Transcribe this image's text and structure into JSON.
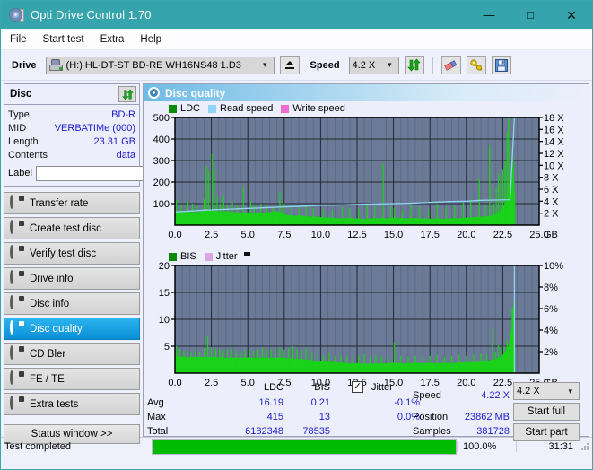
{
  "window": {
    "title": "Opti Drive Control 1.70",
    "icon": "disc-icon",
    "minimize": "—",
    "maximize": "□",
    "close": "✕",
    "titlebar_color": "#35a4ac"
  },
  "menu": {
    "items": [
      {
        "label": "File"
      },
      {
        "label": "Start test"
      },
      {
        "label": "Extra"
      },
      {
        "label": "Help"
      }
    ]
  },
  "toolbar": {
    "drive_label": "Drive",
    "drive_value": "(H:)  HL-DT-ST BD-RE  WH16NS48 1.D3",
    "eject_icon": "eject-icon",
    "speed_label": "Speed",
    "speed_value": "4.2 X",
    "refresh_icon": "refresh-icon",
    "eraser_icon": "eraser-icon",
    "key_icon": "key-icon",
    "save_icon": "save-disk-icon"
  },
  "sidebar": {
    "disc_group": {
      "title": "Disc",
      "refresh_icon": "refresh-icon",
      "rows": [
        {
          "key": "Type",
          "value": "BD-R"
        },
        {
          "key": "MID",
          "value": "VERBATIMe (000)"
        },
        {
          "key": "Length",
          "value": "23.31 GB"
        },
        {
          "key": "Contents",
          "value": "data"
        }
      ],
      "label_key": "Label",
      "label_value": "",
      "label_placeholder": "",
      "label_button_icon": "disc-icon"
    },
    "nav": [
      {
        "label": "Transfer rate",
        "icon": "disc-icon",
        "selected": false
      },
      {
        "label": "Create test disc",
        "icon": "disc-icon",
        "selected": false
      },
      {
        "label": "Verify test disc",
        "icon": "disc-icon",
        "selected": false
      },
      {
        "label": "Drive info",
        "icon": "disc-icon",
        "selected": false
      },
      {
        "label": "Disc info",
        "icon": "disc-icon",
        "selected": false
      },
      {
        "label": "Disc quality",
        "icon": "disc-icon",
        "selected": true
      },
      {
        "label": "CD Bler",
        "icon": "disc-icon",
        "selected": false
      },
      {
        "label": "FE / TE",
        "icon": "disc-icon",
        "selected": false
      },
      {
        "label": "Extra tests",
        "icon": "disc-icon",
        "selected": false
      }
    ],
    "status_window_button": "Status window >>"
  },
  "panel": {
    "title": "Disc quality",
    "icon": "disc-icon"
  },
  "stats": {
    "col_ldc": "LDC",
    "col_bis": "BIS",
    "jitter_label": "Jitter",
    "jitter_checked": true,
    "rows": [
      {
        "name": "Avg",
        "ldc": "16.19",
        "bis": "0.21",
        "jitter": "-0.1%"
      },
      {
        "name": "Max",
        "ldc": "415",
        "bis": "13",
        "jitter": "0.0%"
      },
      {
        "name": "Total",
        "ldc": "6182348",
        "bis": "78535",
        "jitter": ""
      }
    ],
    "speed_label": "Speed",
    "speed_value": "4.22 X",
    "position_label": "Position",
    "position_value": "23862 MB",
    "samples_label": "Samples",
    "samples_value": "381728",
    "speed_select": "4.2 X",
    "start_full": "Start full",
    "start_part": "Start part"
  },
  "statusbar": {
    "message": "Test completed",
    "progress_percent": "100.0%",
    "progress_value": 100,
    "elapsed": "31:31",
    "progress_color": "#00bb00"
  },
  "chart_data": [
    {
      "type": "area",
      "id": "ldc-chart",
      "title": "",
      "xlabel": "GB",
      "ylabel": "",
      "xlim": [
        0,
        25
      ],
      "ylim": [
        0,
        500
      ],
      "y2lim": [
        0,
        18
      ],
      "xticks": [
        "0.0",
        "2.5",
        "5.0",
        "7.5",
        "10.0",
        "12.5",
        "15.0",
        "17.5",
        "20.0",
        "22.5",
        "25.0"
      ],
      "yticks": [
        "100",
        "200",
        "300",
        "400",
        "500"
      ],
      "y2ticks": [
        "2 X",
        "4 X",
        "6 X",
        "8 X",
        "10 X",
        "12 X",
        "14 X",
        "16 X",
        "18 X"
      ],
      "grid": true,
      "plot_bg": "#6b7a96",
      "legend_position": "top-left",
      "legend": [
        {
          "name": "LDC",
          "color": "#0a8a0a"
        },
        {
          "name": "Read speed",
          "color": "#8fd4f2"
        },
        {
          "name": "Write speed",
          "color": "#f06bd2"
        }
      ],
      "series": [
        {
          "name": "LDC",
          "color": "#19d219",
          "type": "area",
          "x": [
            0.0,
            0.25,
            0.5,
            0.75,
            1.0,
            1.25,
            1.5,
            1.75,
            2.0,
            2.25,
            2.5,
            2.75,
            3.0,
            3.25,
            3.5,
            3.75,
            4.0,
            4.25,
            4.5,
            4.75,
            5.0,
            5.25,
            5.5,
            5.75,
            6.0,
            6.25,
            6.5,
            6.75,
            7.0,
            7.25,
            7.5,
            7.75,
            8.0,
            8.25,
            8.5,
            8.75,
            9.0,
            9.25,
            9.5,
            9.75,
            10.0,
            10.5,
            11.0,
            11.5,
            12.0,
            12.5,
            13.0,
            13.5,
            14.0,
            14.5,
            15.0,
            15.5,
            16.0,
            16.5,
            17.0,
            17.5,
            18.0,
            18.5,
            19.0,
            19.5,
            20.0,
            20.5,
            21.0,
            21.5,
            22.0,
            22.25,
            22.5,
            22.75,
            23.0,
            23.2,
            23.35
          ],
          "y": [
            70,
            62,
            58,
            60,
            62,
            60,
            58,
            62,
            70,
            64,
            66,
            68,
            62,
            60,
            64,
            62,
            60,
            58,
            56,
            60,
            58,
            56,
            54,
            58,
            56,
            58,
            60,
            62,
            64,
            60,
            50,
            46,
            44,
            42,
            44,
            42,
            40,
            38,
            40,
            38,
            36,
            34,
            32,
            30,
            32,
            30,
            28,
            30,
            32,
            30,
            34,
            32,
            30,
            32,
            30,
            28,
            30,
            28,
            30,
            32,
            34,
            36,
            38,
            40,
            48,
            60,
            80,
            110,
            190,
            320,
            100
          ]
        },
        {
          "name": "LDC spikes",
          "color": "#19d219",
          "type": "impulse",
          "x": [
            0.1,
            0.45,
            0.9,
            1.2,
            1.55,
            2.0,
            2.15,
            2.3,
            2.55,
            2.7,
            2.9,
            3.1,
            3.35,
            3.6,
            3.95,
            4.3,
            4.7,
            5.2,
            5.45,
            5.9,
            6.3,
            6.7,
            7.2,
            7.5,
            8.0,
            8.5,
            9.0,
            9.5,
            10.2,
            10.8,
            11.5,
            12.0,
            12.6,
            13.2,
            13.7,
            14.3,
            14.8,
            15.05,
            15.6,
            16.2,
            16.8,
            17.4,
            18.0,
            18.6,
            19.2,
            19.8,
            20.3,
            20.9,
            21.3,
            21.6,
            21.9,
            22.05,
            22.2,
            22.35,
            22.5,
            22.65,
            22.8,
            22.9,
            23.0
          ],
          "y": [
            120,
            95,
            110,
            100,
            90,
            120,
            275,
            250,
            330,
            255,
            130,
            100,
            135,
            95,
            110,
            95,
            180,
            110,
            95,
            100,
            90,
            85,
            155,
            100,
            95,
            85,
            90,
            80,
            75,
            70,
            85,
            80,
            75,
            95,
            100,
            285,
            90,
            80,
            70,
            95,
            85,
            75,
            100,
            85,
            90,
            110,
            120,
            215,
            95,
            370,
            100,
            180,
            240,
            215,
            260,
            300,
            430,
            500,
            380
          ]
        },
        {
          "name": "Read speed",
          "color": "#8fd4f2",
          "type": "line",
          "axis": "right",
          "x": [
            0.0,
            1.0,
            2.0,
            3.0,
            4.0,
            5.0,
            6.0,
            7.0,
            8.0,
            9.0,
            10.0,
            11.0,
            12.0,
            13.0,
            14.0,
            15.0,
            16.0,
            17.0,
            18.0,
            19.0,
            20.0,
            21.0,
            22.0,
            23.0,
            23.3,
            23.35
          ],
          "y": [
            2.2,
            2.35,
            2.5,
            2.6,
            2.7,
            2.8,
            2.9,
            3.0,
            3.1,
            3.2,
            3.3,
            3.35,
            3.45,
            3.5,
            3.55,
            3.6,
            3.65,
            3.75,
            3.85,
            3.95,
            4.0,
            4.15,
            4.2,
            4.25,
            18.0,
            18.0
          ]
        }
      ]
    },
    {
      "type": "area",
      "id": "bis-chart",
      "title": "",
      "xlabel": "GB",
      "ylabel": "",
      "xlim": [
        0,
        25
      ],
      "ylim": [
        0,
        20
      ],
      "y2lim": [
        0,
        10
      ],
      "xticks": [
        "0.0",
        "2.5",
        "5.0",
        "7.5",
        "10.0",
        "12.5",
        "15.0",
        "17.5",
        "20.0",
        "22.5",
        "25.0"
      ],
      "yticks": [
        "5",
        "10",
        "15",
        "20"
      ],
      "y2ticks": [
        "2%",
        "4%",
        "6%",
        "8%",
        "10%"
      ],
      "grid": true,
      "plot_bg": "#6b7a96",
      "legend_position": "top-left",
      "legend": [
        {
          "name": "BIS",
          "color": "#0a8a0a"
        },
        {
          "name": "Jitter",
          "color": "#d9a8e0"
        }
      ],
      "series": [
        {
          "name": "BIS",
          "color": "#19d219",
          "type": "area",
          "x": [
            0.0,
            0.5,
            1.0,
            1.5,
            2.0,
            2.5,
            3.0,
            3.5,
            4.0,
            4.5,
            5.0,
            5.5,
            6.0,
            6.5,
            7.0,
            7.5,
            8.0,
            8.5,
            9.0,
            9.5,
            10.0,
            10.5,
            11.0,
            11.5,
            12.0,
            12.5,
            13.0,
            13.5,
            14.0,
            14.5,
            15.0,
            15.5,
            16.0,
            16.5,
            17.0,
            17.5,
            18.0,
            18.5,
            19.0,
            19.5,
            20.0,
            20.5,
            21.0,
            21.5,
            22.0,
            22.3,
            22.6,
            22.9,
            23.1,
            23.25,
            23.35
          ],
          "y": [
            3.2,
            3.0,
            2.9,
            3.0,
            2.9,
            3.0,
            2.9,
            2.8,
            2.9,
            2.8,
            2.9,
            2.8,
            2.9,
            2.8,
            2.9,
            2.8,
            2.7,
            2.6,
            2.5,
            2.3,
            2.2,
            2.1,
            2.0,
            1.9,
            1.8,
            1.8,
            1.7,
            1.7,
            1.8,
            1.8,
            1.9,
            1.8,
            1.8,
            1.9,
            1.8,
            1.9,
            1.8,
            1.9,
            1.8,
            1.9,
            2.0,
            2.0,
            2.1,
            2.3,
            2.6,
            3.0,
            3.6,
            5.0,
            8.0,
            13.2,
            4.0
          ]
        },
        {
          "name": "BIS spikes",
          "color": "#19d219",
          "type": "impulse",
          "x": [
            0.1,
            0.35,
            0.6,
            0.85,
            1.1,
            1.4,
            1.7,
            2.0,
            2.25,
            2.5,
            2.8,
            3.05,
            3.3,
            3.6,
            3.9,
            4.2,
            4.5,
            4.8,
            5.1,
            5.4,
            5.7,
            6.0,
            6.3,
            6.6,
            6.9,
            7.2,
            7.5,
            7.8,
            8.1,
            8.4,
            8.7,
            9.0,
            9.4,
            9.8,
            10.2,
            10.6,
            11.0,
            11.4,
            11.8,
            12.2,
            12.6,
            13.0,
            13.4,
            13.8,
            14.2,
            14.6,
            15.05,
            15.5,
            16.0,
            16.5,
            17.0,
            17.5,
            18.0,
            18.5,
            19.0,
            19.5,
            20.0,
            20.5,
            21.0,
            21.4,
            21.8,
            22.0,
            22.2,
            22.4,
            22.6,
            22.8,
            23.0,
            23.15
          ],
          "y": [
            5.0,
            4.4,
            4.2,
            4.0,
            4.1,
            4.3,
            4.0,
            4.6,
            6.8,
            4.8,
            4.4,
            4.6,
            4.2,
            4.4,
            4.6,
            4.2,
            4.0,
            4.4,
            4.6,
            4.2,
            4.4,
            4.8,
            4.2,
            4.4,
            4.6,
            4.8,
            4.4,
            4.6,
            5.0,
            4.4,
            4.2,
            4.6,
            4.0,
            3.6,
            3.4,
            3.8,
            3.2,
            3.4,
            3.0,
            3.4,
            3.2,
            3.6,
            3.0,
            3.4,
            3.2,
            3.0,
            5.8,
            3.2,
            3.0,
            3.2,
            3.0,
            3.2,
            3.4,
            3.0,
            3.2,
            3.4,
            3.2,
            3.4,
            3.6,
            3.4,
            8.2,
            4.0,
            5.2,
            4.6,
            5.0,
            6.2,
            8.5,
            12.0
          ]
        },
        {
          "name": "Jitter",
          "color": "#8fd4f2",
          "type": "line",
          "axis": "right",
          "x": [
            23.3,
            23.3
          ],
          "y": [
            0,
            10
          ]
        }
      ]
    }
  ]
}
